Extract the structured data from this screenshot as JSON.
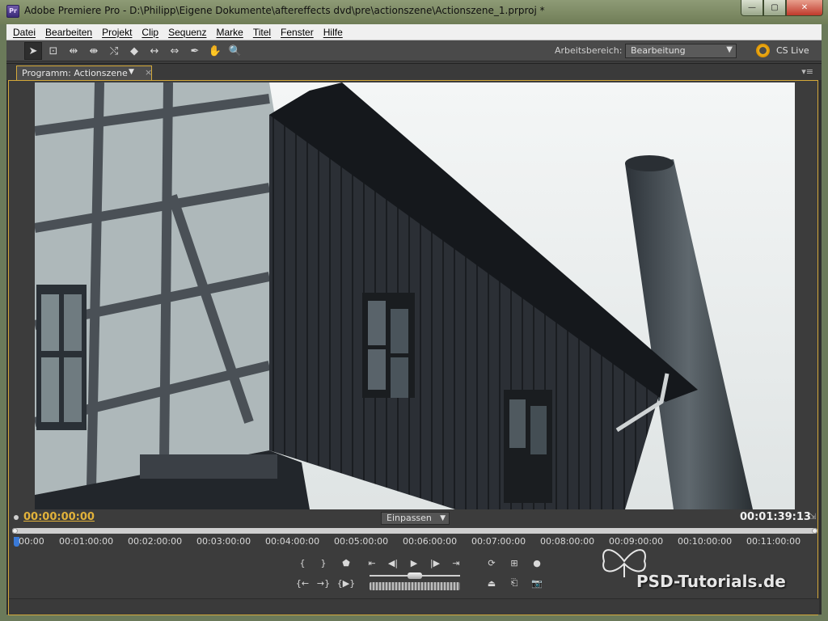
{
  "window": {
    "title": "Adobe Premiere Pro - D:\\Philipp\\Eigene Dokumente\\aftereffects dvd\\pre\\actionszene\\Actionszene_1.prproj *",
    "app_icon_text": "Pr",
    "buttons": {
      "minimize": "—",
      "maximize": "▢",
      "close": "✕"
    }
  },
  "menu": [
    "Datei",
    "Bearbeiten",
    "Projekt",
    "Clip",
    "Sequenz",
    "Marke",
    "Titel",
    "Fenster",
    "Hilfe"
  ],
  "toolbar": {
    "tools": [
      {
        "name": "selection-tool",
        "glyph": "➤"
      },
      {
        "name": "track-select-tool",
        "glyph": "⊡"
      },
      {
        "name": "ripple-edit-tool",
        "glyph": "⇹"
      },
      {
        "name": "rolling-edit-tool",
        "glyph": "⇼"
      },
      {
        "name": "rate-stretch-tool",
        "glyph": "⤭"
      },
      {
        "name": "razor-tool",
        "glyph": "◆"
      },
      {
        "name": "slip-tool",
        "glyph": "↔"
      },
      {
        "name": "slide-tool",
        "glyph": "⇔"
      },
      {
        "name": "pen-tool",
        "glyph": "✒"
      },
      {
        "name": "hand-tool",
        "glyph": "✋"
      },
      {
        "name": "zoom-tool",
        "glyph": "🔍"
      }
    ],
    "workspace_label": "Arbeitsbereich:",
    "workspace_value": "Bearbeitung",
    "cs_live": "CS Live"
  },
  "panel": {
    "tab_label": "Programm: Actionszene",
    "current_time": "00:00:00:00",
    "fit_value": "Einpassen",
    "duration": "00:01:39:13",
    "ruler_labels": [
      "00:00",
      "00:01:00:00",
      "00:02:00:00",
      "00:03:00:00",
      "00:04:00:00",
      "00:05:00:00",
      "00:06:00:00",
      "00:07:00:00",
      "00:08:00:00",
      "00:09:00:00",
      "00:10:00:00",
      "00:11:00:00"
    ]
  },
  "watermark": "PSD-Tutorials.de",
  "colors": {
    "accent": "#d4a93a",
    "timecode": "#e2b23a",
    "playhead": "#3a7ad8"
  }
}
